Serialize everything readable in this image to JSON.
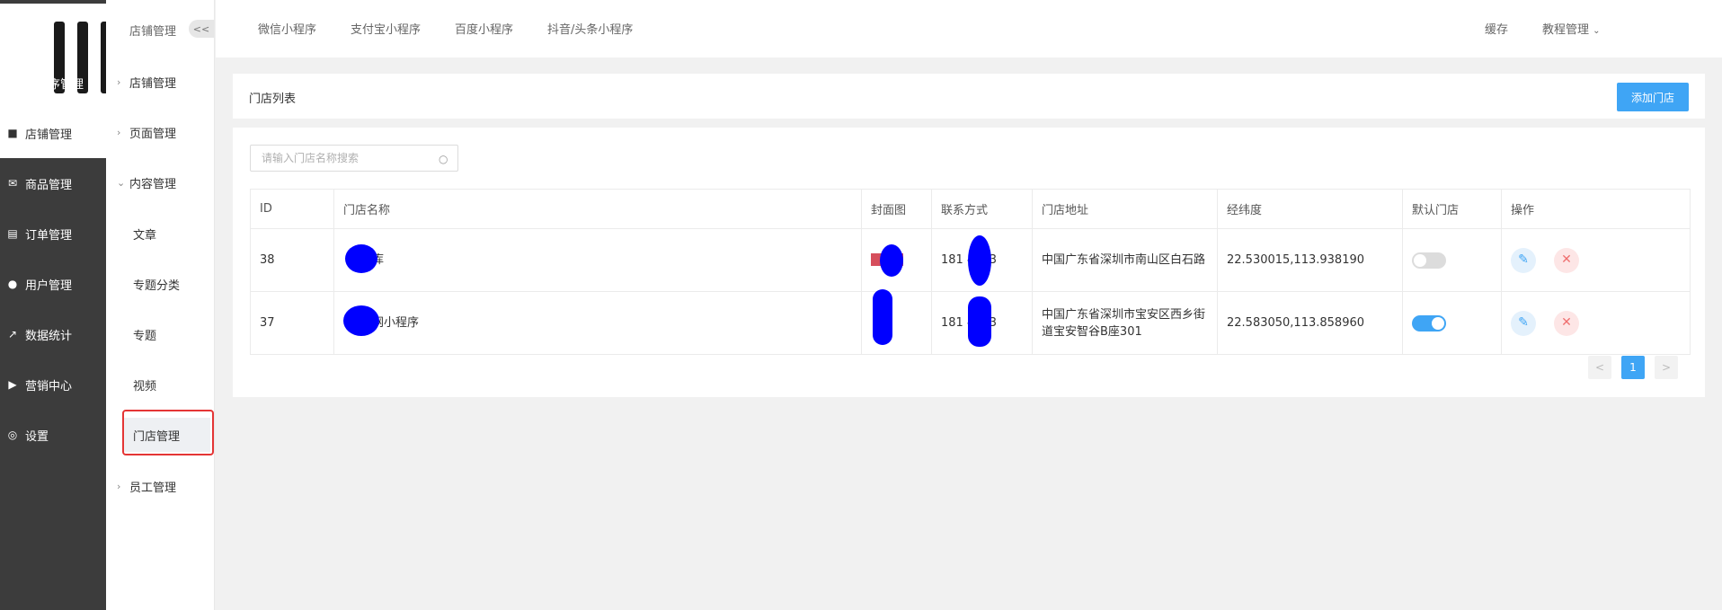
{
  "sidebar": {
    "items": [
      {
        "icon": "link-icon",
        "label": "小程序管理"
      },
      {
        "icon": "store-icon",
        "label": "店铺管理"
      },
      {
        "icon": "mail-icon",
        "label": "商品管理"
      },
      {
        "icon": "clipboard-icon",
        "label": "订单管理"
      },
      {
        "icon": "user-icon",
        "label": "用户管理"
      },
      {
        "icon": "chart-icon",
        "label": "数据统计"
      },
      {
        "icon": "megaphone-icon",
        "label": "营销中心"
      },
      {
        "icon": "gear-icon",
        "label": "设置"
      }
    ]
  },
  "subnav": {
    "title": "店铺管理",
    "collapse": "<<",
    "groups": [
      "店铺管理",
      "页面管理",
      "内容管理",
      "员工管理"
    ],
    "leaves": [
      "文章",
      "专题分类",
      "专题",
      "视频",
      "门店管理"
    ]
  },
  "topbar": {
    "tabs": [
      "微信小程序",
      "支付宝小程序",
      "百度小程序",
      "抖音/头条小程序"
    ],
    "right": [
      "缓存",
      "教程管理"
    ]
  },
  "page": {
    "title": "门店列表",
    "add_button": "添加门店",
    "search_placeholder": "请输入门店名称搜索"
  },
  "table": {
    "columns": [
      "ID",
      "门店名称",
      "封面图",
      "联系方式",
      "门店地址",
      "经纬度",
      "默认门店",
      "操作"
    ],
    "rows": [
      {
        "id": "38",
        "name": "库",
        "phone": "181 4373",
        "address": "中国广东省深圳市南山区白石路",
        "coords": "22.530015,113.938190",
        "default": false
      },
      {
        "id": "37",
        "name": "网小程序",
        "phone": "181 4373",
        "address": "中国广东省深圳市宝安区西乡街道宝安智谷B座301",
        "coords": "22.583050,113.858960",
        "default": true
      }
    ]
  },
  "pagination": {
    "prev": "<",
    "current": "1",
    "next": ">"
  }
}
